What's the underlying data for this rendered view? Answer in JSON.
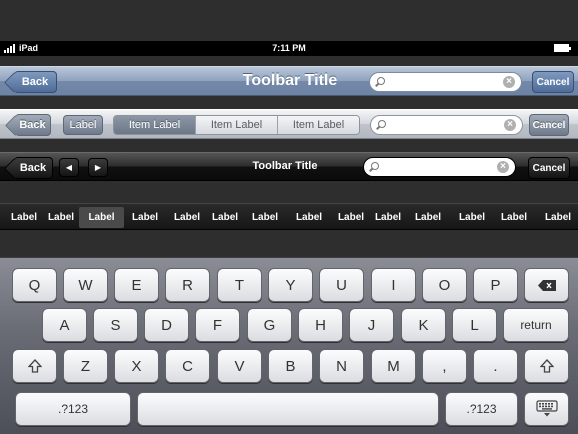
{
  "status_bar": {
    "carrier": "iPad",
    "time": "7:11 PM"
  },
  "toolbar_blue": {
    "back_label": "Back",
    "title": "Toolbar Title",
    "search_placeholder": "",
    "cancel_label": "Cancel"
  },
  "toolbar_silver": {
    "back_label": "Back",
    "label_button": "Label",
    "segments": [
      "Item Label",
      "Item Label",
      "Item Label"
    ],
    "selected_segment": 0,
    "search_placeholder": "",
    "cancel_label": "Cancel"
  },
  "toolbar_black": {
    "back_label": "Back",
    "prev_icon": "left-triangle-icon",
    "next_icon": "right-triangle-icon",
    "title": "Toolbar Title",
    "search_placeholder": "",
    "cancel_label": "Cancel"
  },
  "tab_strip": {
    "items": [
      "Label",
      "Label",
      "Label",
      "Label",
      "Label",
      "Label",
      "Label",
      "Label",
      "Label",
      "Label",
      "Label",
      "Label",
      "Label",
      "Label"
    ],
    "selected_index": 2
  },
  "keyboard": {
    "row1": [
      "Q",
      "W",
      "E",
      "R",
      "T",
      "Y",
      "U",
      "I",
      "O",
      "P"
    ],
    "row2": [
      "A",
      "S",
      "D",
      "F",
      "G",
      "H",
      "J",
      "K",
      "L"
    ],
    "row3": [
      "Z",
      "X",
      "C",
      "V",
      "B",
      "N",
      "M",
      ",",
      "."
    ],
    "return_label": "return",
    "numbers_label": ".?123",
    "backspace_icon": "backspace-icon",
    "shift_icon": "shift-icon",
    "hide_keyboard_icon": "keyboard-hide-icon"
  }
}
